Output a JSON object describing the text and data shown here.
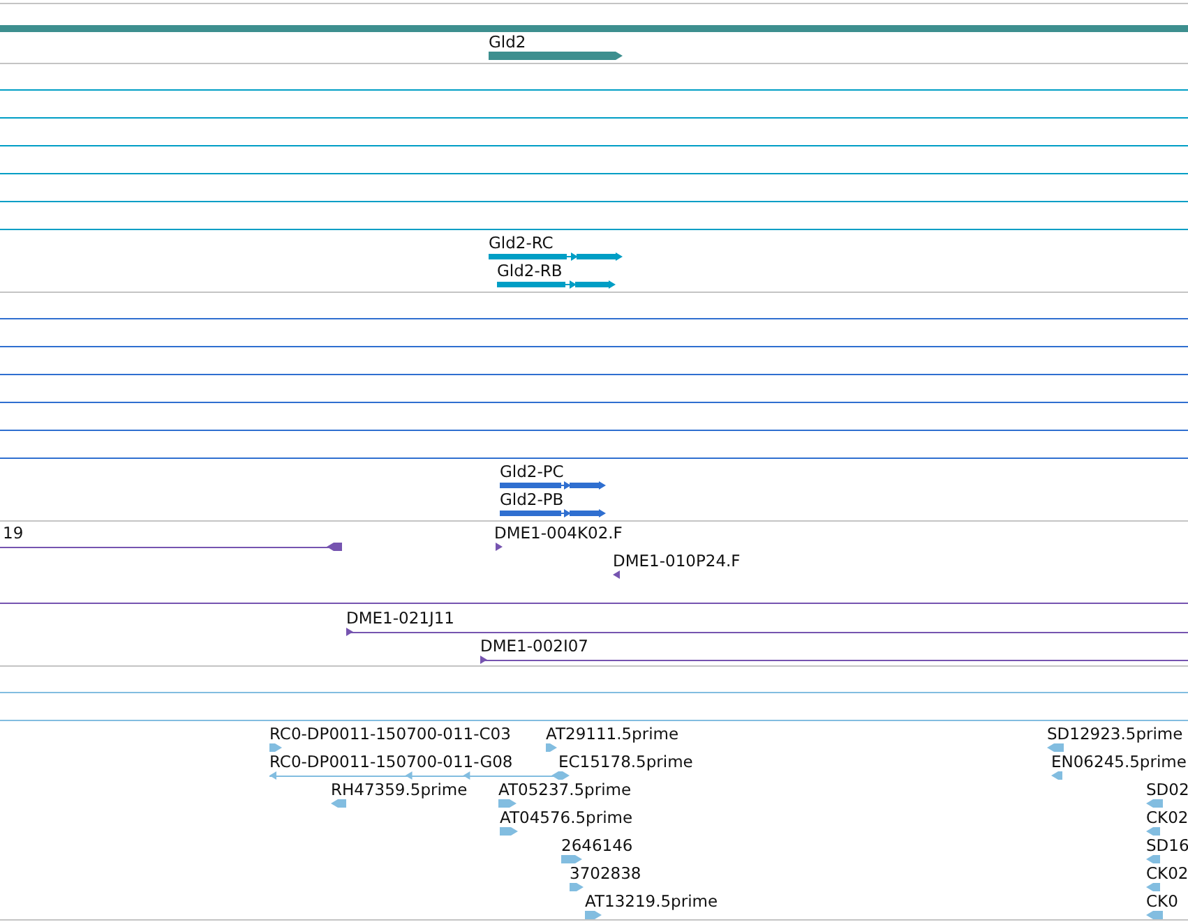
{
  "tracks": [
    {
      "kind": "gene",
      "features": [
        {
          "kind": "bar"
        },
        {
          "kind": "bar",
          "reverse": false,
          "label": "Gld2"
        }
      ]
    },
    {
      "kind": "mrna",
      "features": [
        {
          "kind": "line"
        },
        {
          "kind": "line"
        },
        {
          "kind": "line"
        },
        {
          "kind": "line"
        },
        {
          "kind": "line"
        },
        {
          "kind": "line"
        },
        {
          "kind": "split",
          "reverse": false,
          "label": "Gld2-RC"
        },
        {
          "kind": "split",
          "reverse": false,
          "label": "Gld2-RB"
        }
      ]
    },
    {
      "kind": "protein",
      "features": [
        {
          "kind": "line"
        },
        {
          "kind": "line"
        },
        {
          "kind": "line"
        },
        {
          "kind": "line"
        },
        {
          "kind": "line"
        },
        {
          "kind": "line"
        },
        {
          "kind": "split",
          "reverse": false,
          "label": "Gld2-PC"
        },
        {
          "kind": "split",
          "reverse": false,
          "label": "Gld2-PB"
        }
      ]
    },
    {
      "kind": "clone",
      "features": [
        {
          "kind": "line",
          "reverse": true,
          "label": "19"
        },
        {
          "kind": "marker",
          "reverse": false,
          "label": "DME1-004K02.F"
        },
        {
          "kind": "marker",
          "reverse": true,
          "label": "DME1-010P24.F"
        },
        {
          "kind": "line"
        },
        {
          "kind": "line",
          "reverse": false,
          "label": "DME1-021J11"
        },
        {
          "kind": "line",
          "reverse": false,
          "label": "DME1-002I07"
        }
      ]
    },
    {
      "kind": "est",
      "features": [
        {
          "kind": "line"
        },
        {
          "kind": "line"
        },
        {
          "kind": "marker",
          "reverse": false,
          "label": "RC0-DP0011-150700-011-C03"
        },
        {
          "kind": "marker",
          "reverse": false,
          "label": "AT29111.5prime"
        },
        {
          "kind": "line",
          "reverse": true,
          "label": "RC0-DP0011-150700-011-G08"
        },
        {
          "kind": "marker",
          "reverse": false,
          "label": "EC15178.5prime"
        },
        {
          "kind": "marker",
          "reverse": true,
          "label": "RH47359.5prime"
        },
        {
          "kind": "marker",
          "reverse": false,
          "label": "AT05237.5prime"
        },
        {
          "kind": "marker",
          "reverse": false,
          "label": "AT04576.5prime"
        },
        {
          "kind": "marker",
          "reverse": false,
          "label": "2646146"
        },
        {
          "kind": "marker",
          "reverse": false,
          "label": "3702838"
        },
        {
          "kind": "marker",
          "reverse": false,
          "label": "AT13219.5prime"
        },
        {
          "kind": "marker",
          "reverse": true,
          "label": "SD12923.5prime"
        },
        {
          "kind": "marker",
          "reverse": true,
          "label": "EN06245.5prime"
        },
        {
          "kind": "marker",
          "reverse": true,
          "label": "SD02"
        },
        {
          "kind": "marker",
          "reverse": true,
          "label": "CK02"
        },
        {
          "kind": "marker",
          "reverse": true,
          "label": "SD16"
        },
        {
          "kind": "marker",
          "reverse": true,
          "label": "CK02"
        },
        {
          "kind": "marker",
          "reverse": true,
          "label": "CK0"
        }
      ]
    }
  ]
}
